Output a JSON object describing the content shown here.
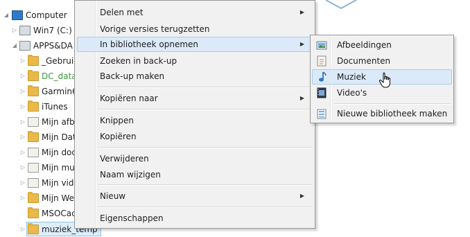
{
  "tree": {
    "items": [
      {
        "label": "Computer",
        "icon": "computer-icon",
        "expanded": true
      },
      {
        "label": "Win7 (C:)",
        "icon": "drive-icon",
        "expanded": false
      },
      {
        "label": "APPS&DA",
        "icon": "drive-icon",
        "expanded": true
      },
      {
        "label": "_Gebruik",
        "icon": "folder-icon",
        "expanded": false
      },
      {
        "label": "DC_data",
        "icon": "folder-icon",
        "expanded": false,
        "color": "#3a9a3a"
      },
      {
        "label": "Garmin6",
        "icon": "folder-icon",
        "expanded": false
      },
      {
        "label": "iTunes",
        "icon": "folder-icon",
        "expanded": false
      },
      {
        "label": "Mijn afb",
        "icon": "library-folder-icon",
        "expanded": false
      },
      {
        "label": "Mijn Dat",
        "icon": "folder-icon",
        "expanded": false
      },
      {
        "label": "Mijn doc",
        "icon": "library-folder-icon",
        "expanded": false
      },
      {
        "label": "Mijn mu",
        "icon": "library-folder-icon",
        "expanded": false
      },
      {
        "label": "Mijn vid",
        "icon": "library-folder-icon",
        "expanded": false
      },
      {
        "label": "Mijn We",
        "icon": "folder-icon",
        "expanded": false
      },
      {
        "label": "MSOCac",
        "icon": "folder-icon",
        "expanded": false
      },
      {
        "label": "muziek_temp",
        "icon": "folder-icon",
        "expanded": false,
        "selected": true
      }
    ]
  },
  "context_menu": {
    "items": [
      {
        "label": "Delen met",
        "submenu": true
      },
      {
        "label": "Vorige versies terugzetten",
        "submenu": false
      },
      {
        "label": "In bibliotheek opnemen",
        "submenu": true,
        "active": true
      },
      {
        "label": "Zoeken in back-up",
        "submenu": false
      },
      {
        "label": "Back-up maken",
        "submenu": false
      },
      {
        "label": "Kopiëren naar",
        "submenu": true
      },
      {
        "label": "Knippen",
        "submenu": false
      },
      {
        "label": "Kopiëren",
        "submenu": false
      },
      {
        "label": "Verwijderen",
        "submenu": false
      },
      {
        "label": "Naam wijzigen",
        "submenu": false
      },
      {
        "label": "Nieuw",
        "submenu": true
      },
      {
        "label": "Eigenschappen",
        "submenu": false
      }
    ]
  },
  "library_submenu": {
    "items": [
      {
        "label": "Afbeeldingen",
        "icon": "pictures-library-icon"
      },
      {
        "label": "Documenten",
        "icon": "documents-library-icon"
      },
      {
        "label": "Muziek",
        "icon": "music-library-icon",
        "hover": true
      },
      {
        "label": "Video's",
        "icon": "video-library-icon"
      },
      {
        "label": "Nieuwe bibliotheek maken",
        "icon": "new-library-icon"
      }
    ]
  },
  "colors": {
    "highlight": "#dbe9f8",
    "highlight_border": "#a8cbef",
    "menu_bg": "#f1f1f1",
    "dc_data_text": "#3a9a3a"
  }
}
